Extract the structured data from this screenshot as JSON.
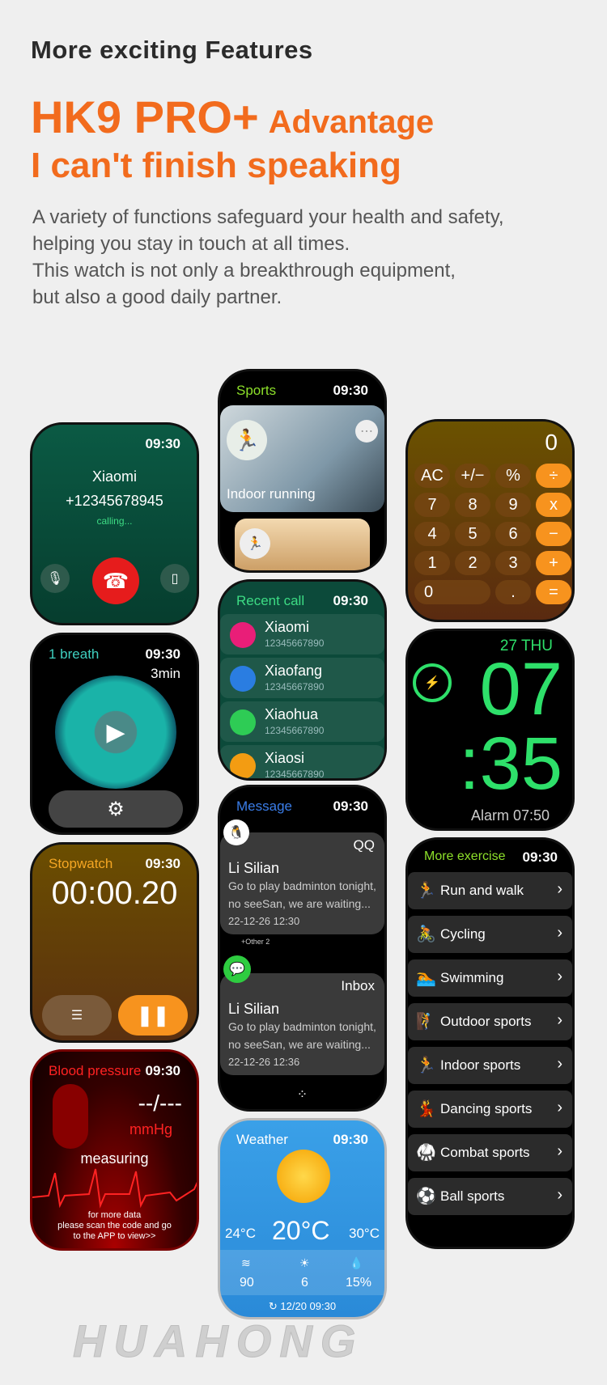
{
  "header": {
    "title": "More exciting Features",
    "model": "HK9 PRO+",
    "advantage": "Advantage",
    "slogan": "I can't finish speaking",
    "description": [
      "A variety of functions safeguard your health and safety,",
      "helping you stay in touch at all times.",
      "This watch is not only a breakthrough equipment,",
      "but also a good daily partner."
    ]
  },
  "time": "09:30",
  "call": {
    "name": "Xiaomi",
    "number": "+12345678945",
    "status": "calling..."
  },
  "breath": {
    "title": "1 breath",
    "duration": "3min"
  },
  "stopwatch": {
    "title": "Stopwatch",
    "value": "00:00.20"
  },
  "bp": {
    "title": "Blood pressure",
    "value": "--/---",
    "unit": "mmHg",
    "status": "measuring",
    "note": [
      "for more data",
      "please scan the code and go",
      "to the APP to view>>"
    ]
  },
  "sports": {
    "title": "Sports",
    "item": "Indoor running"
  },
  "recent": {
    "title": "Recent call",
    "items": [
      {
        "name": "Xiaomi",
        "number": "12345667890",
        "color": "#e91e78"
      },
      {
        "name": "Xiaofang",
        "number": "12345667890",
        "color": "#2a7de1"
      },
      {
        "name": "Xiaohua",
        "number": "12345667890",
        "color": "#2ecc55"
      },
      {
        "name": "Xiaosi",
        "number": "12345667890",
        "color": "#f39c12"
      }
    ]
  },
  "message": {
    "title": "Message",
    "items": [
      {
        "app": "QQ",
        "sender": "Li Silian",
        "line1": "Go to play badminton tonight,",
        "line2": "no seeSan, we are waiting...",
        "date": "22-12-26  12:30",
        "extra": "+Other 2"
      },
      {
        "app": "Inbox",
        "sender": "Li Silian",
        "line1": "Go to play badminton tonight,",
        "line2": "no seeSan, we are waiting...",
        "date": "22-12-26  12:36"
      }
    ]
  },
  "weather": {
    "title": "Weather",
    "low": "24°C",
    "temp": "20°C",
    "high": "30°C",
    "wind": "90",
    "uv": "6",
    "humidity": "15%",
    "updated": "12/20  09:30"
  },
  "calculator": {
    "display": "0",
    "keys": [
      "AC",
      "+/−",
      "%",
      "÷",
      "7",
      "8",
      "9",
      "x",
      "4",
      "5",
      "6",
      "−",
      "1",
      "2",
      "3",
      "+"
    ],
    "zero": "0",
    "dot": ".",
    "equals": "="
  },
  "clock": {
    "date": "27 THU",
    "hour": "07",
    "minute": ":35",
    "alarm": "Alarm 07:50"
  },
  "exercise": {
    "title": "More exercise",
    "items": [
      "Run and walk",
      "Cycling",
      "Swimming",
      "Outdoor sports",
      "Indoor sports",
      "Dancing sports",
      "Combat sports",
      "Ball sports"
    ]
  },
  "watermark": "HUAHONG"
}
